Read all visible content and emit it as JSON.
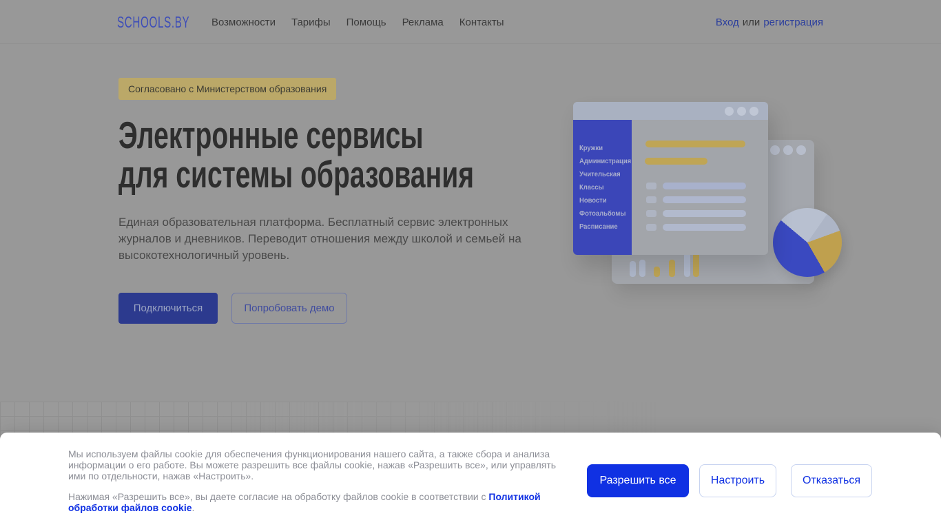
{
  "header": {
    "logo": "SCHOOLS.BY",
    "nav": [
      "Возможности",
      "Тарифы",
      "Помощь",
      "Реклама",
      "Контакты"
    ],
    "auth": {
      "login": "Вход",
      "separator": "или",
      "register": "регистрация"
    }
  },
  "hero": {
    "badge": "Согласовано с Министерством образования",
    "title_line1": "Электронные сервисы",
    "title_line2": "для системы образования",
    "description": "Единая образовательная платформа. Бесплатный сервис электронных журналов и дневников. Переводит отношения между школой и семьей на высокотехнологичный уровень.",
    "cta_primary": "Подключиться",
    "cta_secondary": "Попробовать демо"
  },
  "illustration": {
    "sidebar_items": [
      "Кружки",
      "Администрация",
      "Учительская",
      "Классы",
      "Новости",
      "Фотоальбомы",
      "Расписание"
    ]
  },
  "cookie_banner": {
    "paragraph1": "Мы используем файлы cookie для обеспечения функционирования нашего сайта, а также сбора и анализа информации о его работе. Вы можете разрешить все файлы cookie, нажав «Разрешить все», или управлять ими по отдельности, нажав «Настроить».",
    "paragraph2_prefix": "Нажимая «Разрешить все», вы даете согласие на обработку файлов cookie в соответствии с ",
    "policy_link": "Политикой обработки файлов cookie",
    "paragraph2_suffix": ".",
    "allow_all_label": "Разрешить все",
    "configure_label": "Настроить",
    "decline_label": "Отказаться"
  },
  "colors": {
    "accent_blue": "#1031e3",
    "overlay_dim_gray": "#989898",
    "logo_blue_dimmed": "#3d4db8",
    "badge_yellow_dimmed": "#bba868",
    "primary_button_dimmed": "#2c3a8e",
    "illustration_blue_dimmed": "#3b46b8",
    "illustration_yellow_dimmed": "#bfa555"
  }
}
